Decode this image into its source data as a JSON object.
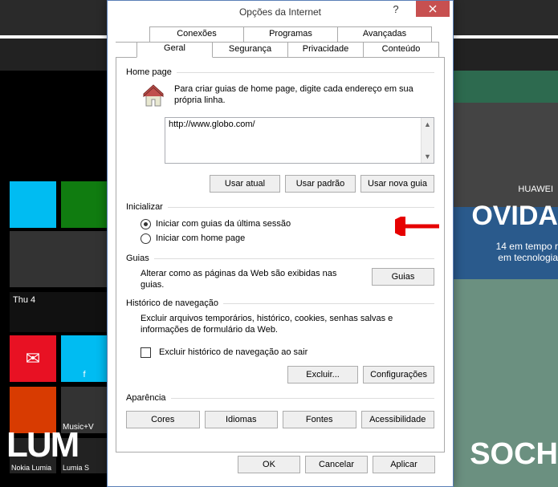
{
  "window": {
    "title": "Opções da Internet",
    "help_tooltip": "?",
    "close_tooltip": "Fechar"
  },
  "tabs_row1": [
    "Conexões",
    "Programas",
    "Avançadas"
  ],
  "tabs_row2": [
    "Geral",
    "Segurança",
    "Privacidade",
    "Conteúdo"
  ],
  "active_tab": "Geral",
  "homepage": {
    "label": "Home page",
    "hint": "Para criar guias de home page, digite cada endereço em sua própria linha.",
    "value": "http://www.globo.com/",
    "btn_current": "Usar atual",
    "btn_default": "Usar padrão",
    "btn_newtab": "Usar nova guia"
  },
  "startup": {
    "label": "Inicializar",
    "opt_last": "Iniciar com guias da última sessão",
    "opt_home": "Iniciar com home page",
    "selected": "last"
  },
  "tabs_section": {
    "label": "Guias",
    "desc": "Alterar como as páginas da Web são exibidas nas guias.",
    "btn": "Guias"
  },
  "history": {
    "label": "Histórico de navegação",
    "desc": "Excluir arquivos temporários, histórico, cookies, senhas salvas e informações de formulário da Web.",
    "chk_exit": "Excluir histórico de navegação ao sair",
    "btn_delete": "Excluir...",
    "btn_settings": "Configurações"
  },
  "appearance": {
    "label": "Aparência",
    "btn_colors": "Cores",
    "btn_lang": "Idiomas",
    "btn_fonts": "Fontes",
    "btn_access": "Acessibilidade"
  },
  "footer": {
    "ok": "OK",
    "cancel": "Cancelar",
    "apply": "Aplicar"
  },
  "bg": {
    "thu": "Thu 4",
    "music": "Music+V",
    "nokia": "Nokia Lumia",
    "lumias": "Lumia S",
    "lum": "LUM",
    "huawei": "HUAWEI",
    "ovida": "OVIDA",
    "tempo1": "14 em tempo r",
    "tempo2": "em tecnologia",
    "soch": "SOCH"
  }
}
